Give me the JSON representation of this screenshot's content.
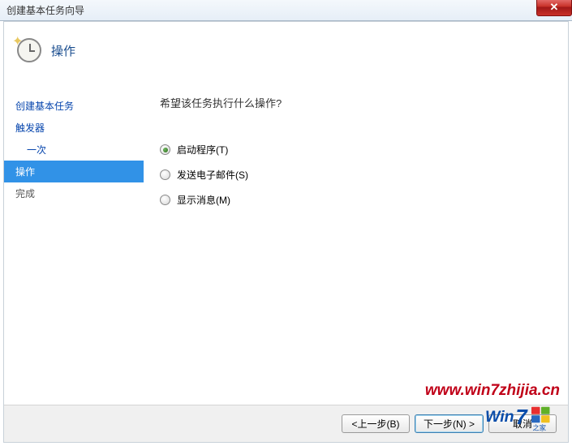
{
  "titlebar": {
    "title": "创建基本任务向导"
  },
  "header": {
    "title": "操作"
  },
  "sidebar": {
    "items": [
      {
        "label": "创建基本任务",
        "indent": false,
        "selected": false
      },
      {
        "label": "触发器",
        "indent": false,
        "selected": false
      },
      {
        "label": "一次",
        "indent": true,
        "selected": false
      },
      {
        "label": "操作",
        "indent": false,
        "selected": true
      },
      {
        "label": "完成",
        "indent": false,
        "selected": false
      }
    ]
  },
  "main": {
    "prompt": "希望该任务执行什么操作?",
    "options": [
      {
        "label": "启动程序(T)",
        "checked": true
      },
      {
        "label": "发送电子邮件(S)",
        "checked": false
      },
      {
        "label": "显示消息(M)",
        "checked": false
      }
    ]
  },
  "footer": {
    "back": "<上一步(B)",
    "next": "下一步(N) >",
    "cancel": "取消"
  },
  "watermark": {
    "url": "www.win7zhijia.cn",
    "logo_text": "Win7"
  }
}
